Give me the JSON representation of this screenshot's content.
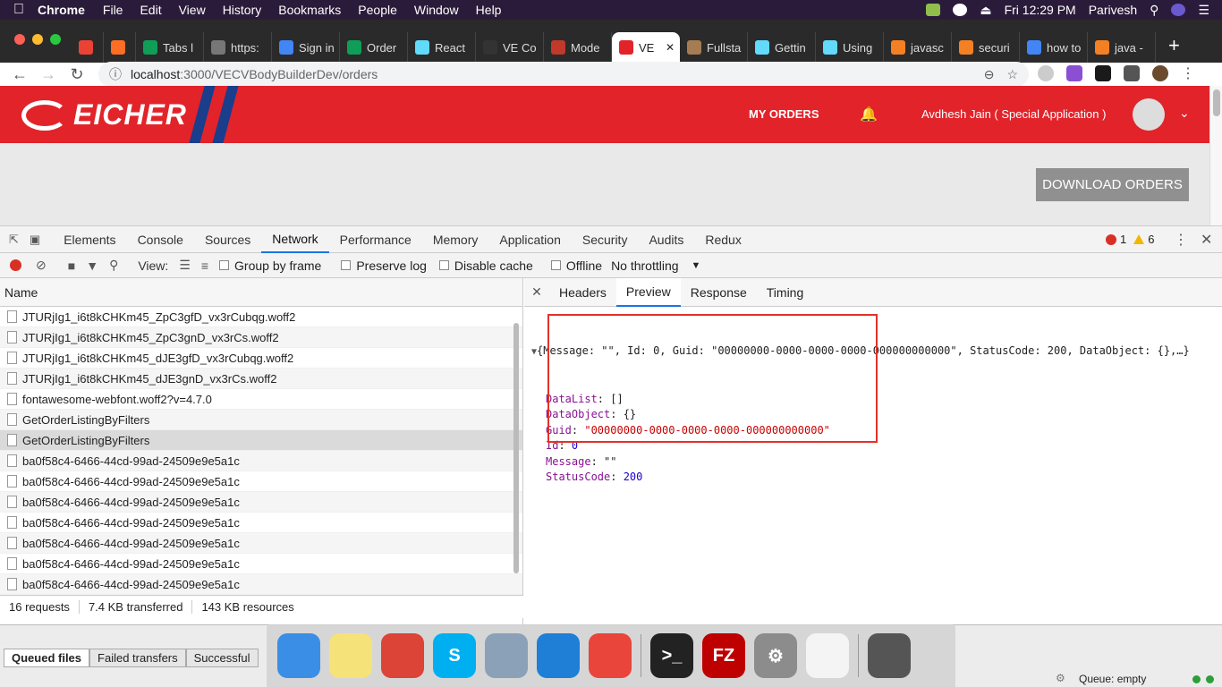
{
  "menubar": {
    "app": "Chrome",
    "items": [
      "File",
      "Edit",
      "View",
      "History",
      "Bookmarks",
      "People",
      "Window",
      "Help"
    ],
    "clock": "Fri 12:29 PM",
    "user": "Parivesh"
  },
  "tabs": [
    {
      "label": "",
      "favicon": "gmail-icon",
      "color": "#ea4335"
    },
    {
      "label": "",
      "favicon": "gitlab-icon",
      "color": "#fc6d26"
    },
    {
      "label": "Tabs l",
      "favicon": "sheets-icon",
      "color": "#0f9d58"
    },
    {
      "label": "https:",
      "favicon": "globe-icon",
      "color": "#777777"
    },
    {
      "label": "Sign in",
      "favicon": "google-icon",
      "color": "#4285f4"
    },
    {
      "label": "Order",
      "favicon": "sheets-icon",
      "color": "#0f9d58"
    },
    {
      "label": "React",
      "favicon": "react-icon",
      "color": "#61dafb"
    },
    {
      "label": "VE Co",
      "favicon": "github-icon",
      "color": "#333333"
    },
    {
      "label": "Mode",
      "favicon": "brand-icon",
      "color": "#c0392b"
    },
    {
      "label": "VE",
      "favicon": "eicher-icon",
      "color": "#e2232a",
      "active": true
    },
    {
      "label": "Fullsta",
      "favicon": "cookie-icon",
      "color": "#a67c52"
    },
    {
      "label": "Gettin",
      "favicon": "react-icon",
      "color": "#61dafb"
    },
    {
      "label": "Using",
      "favicon": "react-icon",
      "color": "#61dafb"
    },
    {
      "label": "javasc",
      "favicon": "stackoverflow-icon",
      "color": "#f48024"
    },
    {
      "label": "securi",
      "favicon": "stackoverflow-icon",
      "color": "#f48024"
    },
    {
      "label": "how to",
      "favicon": "google-icon",
      "color": "#4285f4"
    },
    {
      "label": "java -",
      "favicon": "stackoverflow-icon",
      "color": "#f48024"
    }
  ],
  "address": {
    "host": "localhost",
    "path": ":3000/VECVBodyBuilderDev/orders"
  },
  "site": {
    "brand": "EICHER",
    "my_orders": "MY ORDERS",
    "user": "Avdhesh Jain ( Special Application )",
    "download": "DOWNLOAD ORDERS",
    "brand_color": "#e2232a",
    "stripe_color": "#1a3d8c"
  },
  "devtools": {
    "tabs": [
      "Elements",
      "Console",
      "Sources",
      "Network",
      "Performance",
      "Memory",
      "Application",
      "Security",
      "Audits",
      "Redux"
    ],
    "active_tab": "Network",
    "errors": "1",
    "warnings": "6",
    "net": {
      "view": "View:",
      "group_by_frame": "Group by frame",
      "preserve_log": "Preserve log",
      "disable_cache": "Disable cache",
      "offline": "Offline",
      "throttling": "No throttling"
    },
    "name_header": "Name",
    "requests": [
      "JTURjIg1_i6t8kCHKm45_ZpC3gfD_vx3rCubqg.woff2",
      "JTURjIg1_i6t8kCHKm45_ZpC3gnD_vx3rCs.woff2",
      "JTURjIg1_i6t8kCHKm45_dJE3gfD_vx3rCubqg.woff2",
      "JTURjIg1_i6t8kCHKm45_dJE3gnD_vx3rCs.woff2",
      "fontawesome-webfont.woff2?v=4.7.0",
      "GetOrderListingByFilters",
      "GetOrderListingByFilters",
      "ba0f58c4-6466-44cd-99ad-24509e9e5a1c",
      "ba0f58c4-6466-44cd-99ad-24509e9e5a1c",
      "ba0f58c4-6466-44cd-99ad-24509e9e5a1c",
      "ba0f58c4-6466-44cd-99ad-24509e9e5a1c",
      "ba0f58c4-6466-44cd-99ad-24509e9e5a1c",
      "ba0f58c4-6466-44cd-99ad-24509e9e5a1c",
      "ba0f58c4-6466-44cd-99ad-24509e9e5a1c"
    ],
    "selected_index": 6,
    "status": {
      "requests": "16 requests",
      "transferred": "7.4 KB transferred",
      "resources": "143 KB resources"
    },
    "detail_tabs": [
      "Headers",
      "Preview",
      "Response",
      "Timing"
    ],
    "active_detail": "Preview",
    "preview": {
      "summary": "{Message: \"\", Id: 0, Guid: \"00000000-0000-0000-0000-000000000000\", StatusCode: 200, DataObject: {},…}",
      "fields": [
        {
          "key": "DataList",
          "value": "[]",
          "kind": "plain"
        },
        {
          "key": "DataObject",
          "value": "{}",
          "kind": "plain"
        },
        {
          "key": "Guid",
          "value": "\"00000000-0000-0000-0000-000000000000\"",
          "kind": "string"
        },
        {
          "key": "Id",
          "value": "0",
          "kind": "number"
        },
        {
          "key": "Message",
          "value": "\"\"",
          "kind": "plain"
        },
        {
          "key": "StatusCode",
          "value": "200",
          "kind": "number"
        }
      ]
    }
  },
  "filezilla": {
    "tabs": [
      "Queued files",
      "Failed transfers",
      "Successful"
    ],
    "queue": "Queue: empty"
  },
  "dock": [
    {
      "name": "finder-icon",
      "color": "#3a8ee6",
      "glyph": ""
    },
    {
      "name": "notes-icon",
      "color": "#f5e37a",
      "glyph": ""
    },
    {
      "name": "chrome-icon",
      "color": "#db4437",
      "glyph": ""
    },
    {
      "name": "skype-icon",
      "color": "#00aff0",
      "glyph": "S"
    },
    {
      "name": "preview-icon",
      "color": "#8aa1b8",
      "glyph": ""
    },
    {
      "name": "vscode-icon",
      "color": "#1f7ed6",
      "glyph": ""
    },
    {
      "name": "xampp-icon",
      "color": "#e9453a",
      "glyph": ""
    },
    {
      "sep": true
    },
    {
      "name": "terminal-icon",
      "color": "#222222",
      "glyph": ">_"
    },
    {
      "name": "filezilla-icon",
      "color": "#bf0000",
      "glyph": "FZ"
    },
    {
      "name": "system-preferences-icon",
      "color": "#8c8c8c",
      "glyph": "⚙"
    },
    {
      "name": "reminders-icon",
      "color": "#f4f4f4",
      "glyph": ""
    },
    {
      "sep": true
    },
    {
      "name": "trash-icon",
      "color": "#555555",
      "glyph": ""
    }
  ]
}
